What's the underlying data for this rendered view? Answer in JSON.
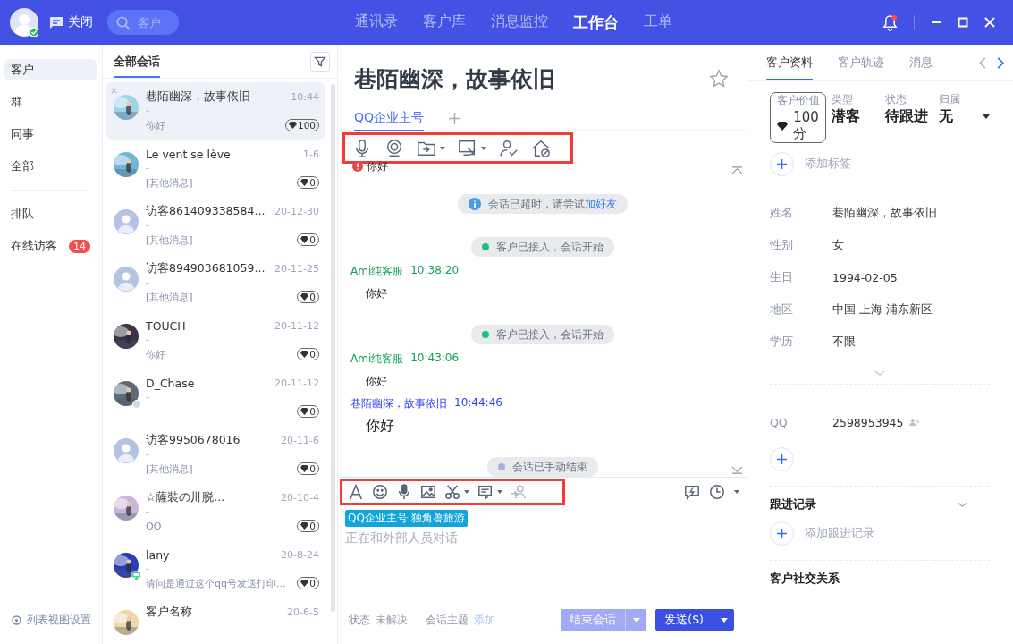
{
  "topbar": {
    "close_label": "关闭",
    "search": {
      "placeholder": "客户"
    },
    "nav": [
      {
        "label": "通讯录",
        "selected": false
      },
      {
        "label": "客户库",
        "selected": false
      },
      {
        "label": "消息监控",
        "selected": false
      },
      {
        "label": "工作台",
        "selected": true
      },
      {
        "label": "工单",
        "selected": false
      }
    ]
  },
  "sidebar": {
    "items": [
      {
        "label": "客户",
        "selected": true
      },
      {
        "label": "群",
        "selected": false
      },
      {
        "label": "同事",
        "selected": false
      },
      {
        "label": "全部",
        "selected": false
      },
      {
        "label": "排队",
        "selected": false
      },
      {
        "label": "在线访客",
        "selected": false,
        "badge": "14"
      }
    ],
    "footer": "列表视图设置"
  },
  "conversations": {
    "tab": "全部会话",
    "items": [
      {
        "name": "巷陌幽深，故事依旧",
        "sub": "-",
        "time": "10:44",
        "preview": "你好",
        "score": "100",
        "selected": true,
        "kind": "contact",
        "offline": false,
        "on_pc": false
      },
      {
        "name": "Le vent se lève",
        "sub": "-",
        "time": "1-6",
        "preview": "[其他消息]",
        "score": "0",
        "selected": false,
        "kind": "contact",
        "offline": false,
        "on_pc": false
      },
      {
        "name": "访客861409338584...",
        "sub": "-",
        "time": "20-12-30",
        "preview": "[其他消息]",
        "score": "0",
        "selected": false,
        "kind": "visitor",
        "offline": false,
        "on_pc": false
      },
      {
        "name": "访客894903681059...",
        "sub": "-",
        "time": "20-11-25",
        "preview": "[其他消息]",
        "score": "0",
        "selected": false,
        "kind": "visitor",
        "offline": false,
        "on_pc": false
      },
      {
        "name": "TOUCH",
        "sub": "-",
        "time": "20-11-12",
        "preview": "你好",
        "score": "0",
        "selected": false,
        "kind": "contact",
        "offline": false,
        "on_pc": false
      },
      {
        "name": "D_Chase",
        "sub": "-",
        "time": "20-11-12",
        "score": "0",
        "selected": false,
        "kind": "contact",
        "offline": true,
        "on_pc": false
      },
      {
        "name": "访客9950678016",
        "sub": "-",
        "time": "20-11-6",
        "preview": "[其他消息]",
        "score": "0",
        "selected": false,
        "kind": "visitor",
        "offline": false,
        "on_pc": false
      },
      {
        "name": "☆薩裝の卅脱...",
        "sub": "-",
        "time": "20-10-4",
        "preview": "QQ",
        "score": "0",
        "selected": false,
        "kind": "contact",
        "offline": false,
        "on_pc": false
      },
      {
        "name": "lany",
        "sub": "-",
        "time": "20-8-24",
        "preview": "请问是通过这个qq号发送打印...",
        "score": "0",
        "selected": false,
        "kind": "contact",
        "offline": false,
        "on_pc": true
      },
      {
        "name": "客户名称",
        "time": "20-6-5",
        "selected": false,
        "kind": "contact",
        "offline": false,
        "on_pc": false
      }
    ]
  },
  "chat": {
    "title": "巷陌幽深，故事依旧",
    "tabs": [
      {
        "label": "QQ企业主号",
        "selected": true
      }
    ],
    "messages": [
      {
        "kind": "failed",
        "text": "你好"
      },
      {
        "kind": "info",
        "text": "会话已超时，请尝试",
        "link": "加好友"
      },
      {
        "kind": "notice",
        "color": "#19c37d",
        "text": "客户已接入，会话开始"
      },
      {
        "kind": "agent",
        "sender": "Ami纯客服",
        "time": "10:38:20",
        "text": "你好"
      },
      {
        "kind": "notice",
        "color": "#19c37d",
        "text": "客户已接入，会话开始"
      },
      {
        "kind": "agent",
        "sender": "Ami纯客服",
        "time": "10:43:06",
        "text": "你好"
      },
      {
        "kind": "customer",
        "sender": "巷陌幽深，故事依旧",
        "time": "10:44:46",
        "text": "你好"
      },
      {
        "kind": "notice",
        "color": "#a7b0d8",
        "text": "会话已手动结束"
      }
    ],
    "input": {
      "tag": "QQ企业主号 独角兽旅游",
      "placeholder": "正在和外部人员对话"
    },
    "footer": {
      "status_label": "状态",
      "status": "未解决",
      "topic_label": "会话主题",
      "topic_action": "添加",
      "end_button": "结束会话",
      "send_button": "发送(S)"
    }
  },
  "profile": {
    "tabs": [
      {
        "label": "客户资料",
        "selected": true
      },
      {
        "label": "客户轨迹",
        "selected": false
      },
      {
        "label": "消息",
        "selected": false
      }
    ],
    "summary": [
      {
        "label": "客户价值",
        "value": "100",
        "unit": "分",
        "kind": "score"
      },
      {
        "label": "类型",
        "value": "潜客",
        "kind": "text"
      },
      {
        "label": "状态",
        "value": "待跟进",
        "kind": "text"
      },
      {
        "label": "归属",
        "value": "无",
        "kind": "select"
      }
    ],
    "add_tag": "添加标签",
    "fields": [
      {
        "label": "姓名",
        "value": "巷陌幽深，故事依旧"
      },
      {
        "label": "性别",
        "value": "女"
      },
      {
        "label": "生日",
        "value": "1994-02-05"
      },
      {
        "label": "地区",
        "value": "中国 上海 浦东新区"
      },
      {
        "label": "学历",
        "value": "不限"
      }
    ],
    "accounts": [
      {
        "label": "QQ",
        "value": "2598953945"
      }
    ],
    "followup": {
      "title": "跟进记录",
      "add": "添加跟进记录"
    },
    "social": {
      "title": "客户社交关系"
    }
  }
}
